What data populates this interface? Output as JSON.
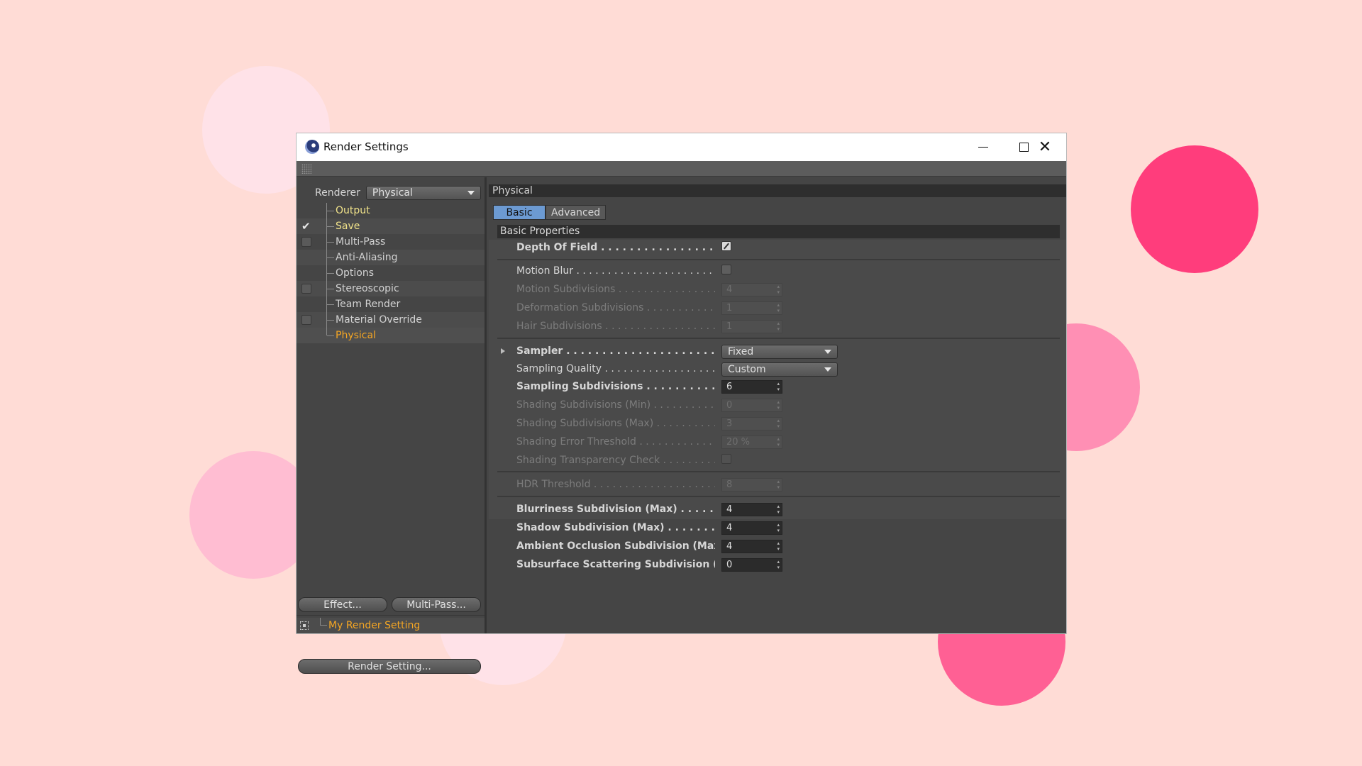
{
  "window": {
    "title": "Render Settings"
  },
  "left": {
    "renderer_label": "Renderer",
    "renderer_value": "Physical",
    "tree": [
      {
        "label": "Output",
        "check": "none",
        "color": "yellow"
      },
      {
        "label": "Save",
        "check": "checked",
        "color": "yellow"
      },
      {
        "label": "Multi-Pass",
        "check": "unchecked",
        "color": "normal"
      },
      {
        "label": "Anti-Aliasing",
        "check": "none",
        "color": "normal"
      },
      {
        "label": "Options",
        "check": "none",
        "color": "normal"
      },
      {
        "label": "Stereoscopic",
        "check": "unchecked",
        "color": "normal"
      },
      {
        "label": "Team Render",
        "check": "none",
        "color": "normal"
      },
      {
        "label": "Material Override",
        "check": "unchecked",
        "color": "normal"
      },
      {
        "label": "Physical",
        "check": "none",
        "color": "orange"
      }
    ],
    "effect_button": "Effect...",
    "multipass_button": "Multi-Pass...",
    "render_setting_name": "My Render Setting",
    "render_setting_button": "Render Setting..."
  },
  "right": {
    "panel_title": "Physical",
    "tabs": [
      {
        "label": "Basic",
        "active": true
      },
      {
        "label": "Advanced",
        "active": false
      }
    ],
    "section_title": "Basic Properties",
    "props": {
      "depth_of_field": {
        "label": "Depth Of Field",
        "checked": true
      },
      "motion_blur": {
        "label": "Motion Blur",
        "checked": false
      },
      "motion_subdivisions": {
        "label": "Motion Subdivisions",
        "value": "4"
      },
      "deformation_subdivisions": {
        "label": "Deformation Subdivisions",
        "value": "1"
      },
      "hair_subdivisions": {
        "label": "Hair Subdivisions",
        "value": "1"
      },
      "sampler": {
        "label": "Sampler",
        "value": "Fixed"
      },
      "sampling_quality": {
        "label": "Sampling Quality",
        "value": "Custom"
      },
      "sampling_subdivisions": {
        "label": "Sampling Subdivisions",
        "value": "6"
      },
      "shading_sub_min": {
        "label": "Shading Subdivisions (Min)",
        "value": "0"
      },
      "shading_sub_max": {
        "label": "Shading Subdivisions (Max)",
        "value": "3"
      },
      "shading_error": {
        "label": "Shading Error Threshold",
        "value": "20 %"
      },
      "shading_transparency": {
        "label": "Shading Transparency Check",
        "checked": false
      },
      "hdr_threshold": {
        "label": "HDR Threshold",
        "value": "8"
      },
      "blurriness_sub": {
        "label": "Blurriness Subdivision (Max)",
        "value": "4"
      },
      "shadow_sub": {
        "label": "Shadow Subdivision (Max)",
        "value": "4"
      },
      "ao_sub": {
        "label": "Ambient Occlusion Subdivision (Max)",
        "value": "4"
      },
      "sss_sub": {
        "label": "Subsurface Scattering Subdivision (Max)",
        "value": "0"
      }
    }
  }
}
